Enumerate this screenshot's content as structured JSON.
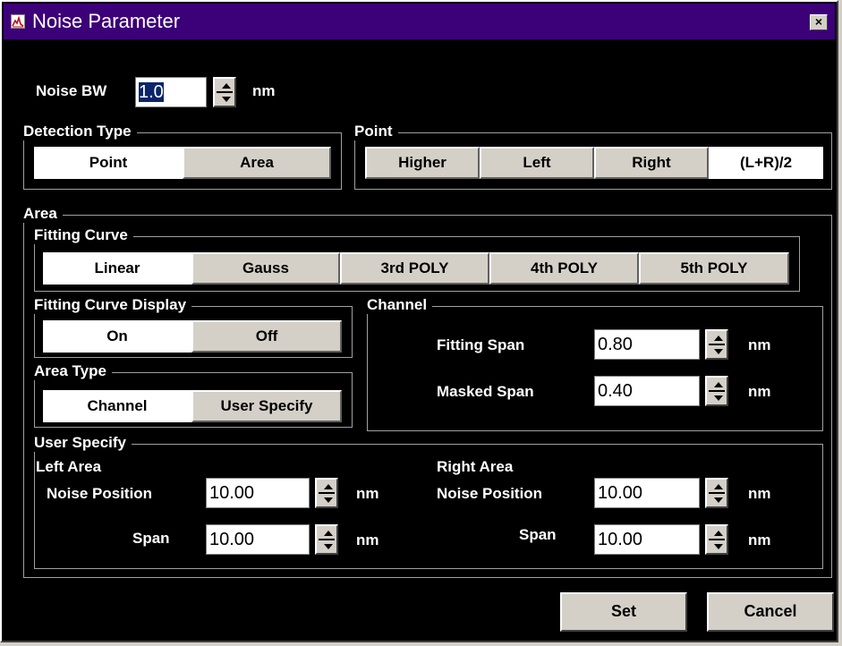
{
  "window": {
    "title": "Noise Parameter",
    "close_label": "×"
  },
  "noise_bw": {
    "label": "Noise BW",
    "value": "1.0",
    "unit": "nm"
  },
  "detection_type": {
    "legend": "Detection Type",
    "options": [
      "Point",
      "Area"
    ],
    "selected": "Point"
  },
  "point": {
    "legend": "Point",
    "options": [
      "Higher",
      "Left",
      "Right",
      "(L+R)/2"
    ],
    "selected": "(L+R)/2"
  },
  "area": {
    "legend": "Area",
    "fitting_curve": {
      "legend": "Fitting Curve",
      "options": [
        "Linear",
        "Gauss",
        "3rd POLY",
        "4th POLY",
        "5th POLY"
      ],
      "selected": "Linear"
    },
    "fitting_curve_display": {
      "legend": "Fitting Curve Display",
      "options": [
        "On",
        "Off"
      ],
      "selected": "On"
    },
    "area_type": {
      "legend": "Area Type",
      "options": [
        "Channel",
        "User Specify"
      ],
      "selected": "Channel"
    },
    "channel": {
      "legend": "Channel",
      "fitting_span": {
        "label": "Fitting Span",
        "value": "0.80",
        "unit": "nm"
      },
      "masked_span": {
        "label": "Masked Span",
        "value": "0.40",
        "unit": "nm"
      }
    },
    "user_specify": {
      "legend": "User Specify",
      "left": {
        "title": "Left Area",
        "noise_position": {
          "label": "Noise Position",
          "value": "10.00",
          "unit": "nm"
        },
        "span": {
          "label": "Span",
          "value": "10.00",
          "unit": "nm"
        }
      },
      "right": {
        "title": "Right Area",
        "noise_position": {
          "label": "Noise Position",
          "value": "10.00",
          "unit": "nm"
        },
        "span": {
          "label": "Span",
          "value": "10.00",
          "unit": "nm"
        }
      }
    }
  },
  "buttons": {
    "set": "Set",
    "cancel": "Cancel"
  },
  "colors": {
    "titlebar": "#3c0078",
    "background": "#000000",
    "button_face": "#d4d0c8",
    "selected": "#ffffff",
    "text_highlight": "#0a246a"
  }
}
